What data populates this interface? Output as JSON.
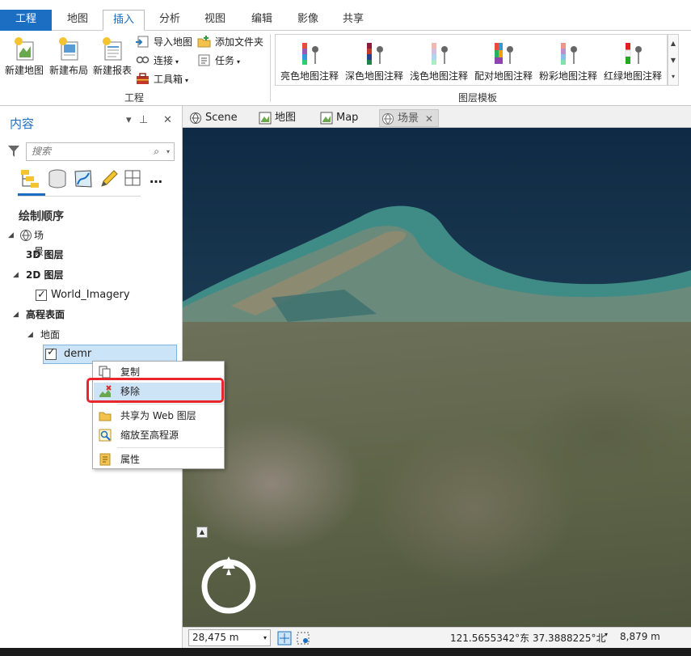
{
  "ribbon": {
    "tabs": [
      "工程",
      "地图",
      "插入",
      "分析",
      "视图",
      "编辑",
      "影像",
      "共享"
    ],
    "active_tab": "插入",
    "project_group": {
      "big_buttons": [
        "新建地图",
        "新建布局",
        "新建报表"
      ],
      "small_buttons": [
        "导入地图",
        "连接",
        "工具箱",
        "添加文件夹",
        "任务"
      ],
      "label": "工程"
    },
    "layer_templates": {
      "items": [
        "亮色地图注释",
        "深色地图注释",
        "浅色地图注释",
        "配对地图注释",
        "粉彩地图注释",
        "红绿地图注释"
      ],
      "label": "图层模板"
    }
  },
  "contents": {
    "title": "内容",
    "search_placeholder": "搜索",
    "drawing_order": "绘制顺序",
    "tree": {
      "scene": "场景",
      "layers_3d": "3D 图层",
      "layers_2d": "2D 图层",
      "world_imagery": "World_Imagery",
      "elevation_surfaces": "高程表面",
      "ground": "地面",
      "demr": "demr"
    }
  },
  "map_tabs": [
    "Scene",
    "地图",
    "Map",
    "场景"
  ],
  "context_menu": {
    "items": [
      "复制",
      "移除",
      "共享为 Web 图层",
      "缩放至高程源",
      "属性"
    ],
    "highlighted": "移除"
  },
  "status_bar": {
    "scale": "28,475 m",
    "coordinates": "121.5655342°东 37.3888225°北",
    "elevation": "8,879 m"
  },
  "colors": {
    "accent": "#1b6ec2",
    "highlight_box": "#e8262b",
    "selection": "#cce4f7"
  }
}
